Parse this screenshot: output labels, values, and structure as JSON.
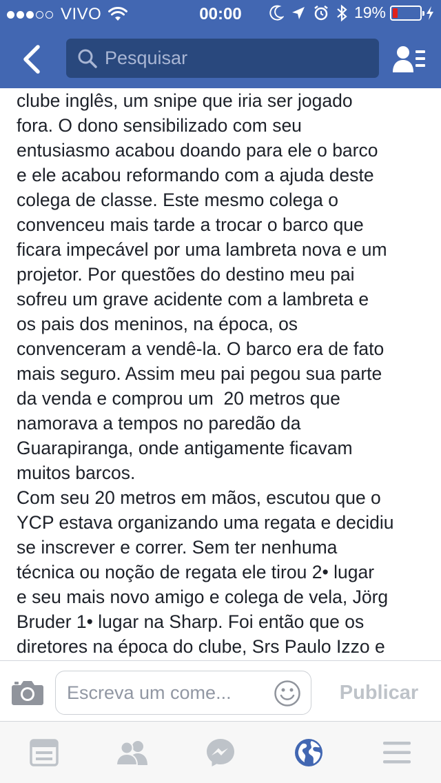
{
  "status_bar": {
    "carrier": "VIVO",
    "time": "00:00",
    "battery_percent_label": "19%",
    "battery_level": 0.19,
    "signal_bars_filled": 3,
    "signal_bars_total": 5
  },
  "nav": {
    "search_placeholder": "Pesquisar",
    "icons": {
      "back": "chevron-left-icon",
      "search": "search-icon",
      "friends": "friends-list-icon"
    }
  },
  "post": {
    "lines": [
      "clube inglês, um snipe que iria ser jogado",
      "fora. O dono sensibilizado com seu",
      "entusiasmo acabou doando para ele o barco",
      "e ele acabou reformando com a ajuda deste",
      "colega de classe. Este mesmo colega o",
      "convenceu mais tarde a trocar o barco que",
      "ficara impecável por uma lambreta nova e um",
      "projetor. Por questões do destino meu pai",
      "sofreu um grave acidente com a lambreta e",
      "os pais dos meninos, na época, os",
      "convenceram a vendê-la. O barco era de fato",
      "mais seguro. Assim meu pai pegou sua parte",
      "da venda e comprou um  20 metros que",
      "namorava a tempos no paredão da",
      "Guarapiranga, onde antigamente ficavam",
      "muitos barcos.",
      "Com seu 20 metros em mãos, escutou que o",
      "YCP estava organizando uma regata e decidiu",
      "se inscrever e correr. Sem ter nenhuma",
      "técnica ou noção de regata ele tirou 2• lugar",
      "e seu mais novo amigo e colega de vela, Jörg",
      "Bruder 1• lugar na Sharp. Foi então que os",
      "diretores na época do clube, Srs Paulo Izzo e"
    ]
  },
  "comment_bar": {
    "placeholder": "Escreva um come...",
    "publish_label": "Publicar",
    "icons": {
      "camera": "camera-icon",
      "emoji": "smiley-icon"
    }
  },
  "tab_bar": {
    "tabs": [
      {
        "name": "news-feed",
        "icon": "news-feed-icon",
        "active": false
      },
      {
        "name": "friend-requests",
        "icon": "friends-icon",
        "active": false
      },
      {
        "name": "messenger",
        "icon": "messenger-icon",
        "active": false
      },
      {
        "name": "notifications",
        "icon": "globe-icon",
        "active": true
      },
      {
        "name": "more",
        "icon": "menu-icon",
        "active": false
      }
    ]
  },
  "colors": {
    "brand_blue": "#4267b2",
    "search_bg": "#29487d",
    "active_tab": "#4267b2",
    "inactive_tab": "#bec3c9",
    "battery_low": "#e0201b"
  }
}
